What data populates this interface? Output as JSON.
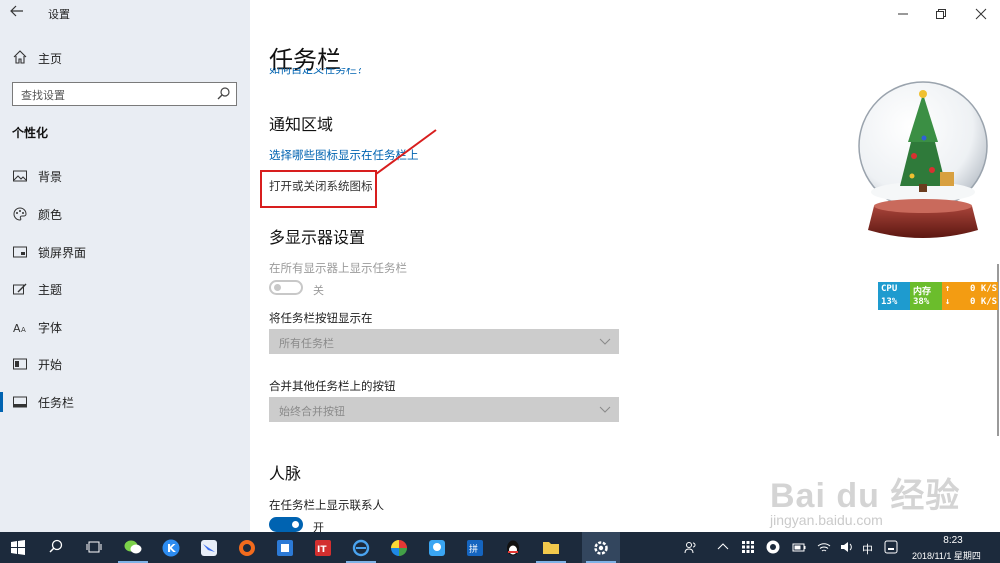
{
  "app": {
    "title": "设置"
  },
  "sidebar": {
    "home_label": "主页",
    "search_placeholder": "查找设置",
    "section_heading": "个性化",
    "items": [
      {
        "label": "背景",
        "icon": "picture-icon"
      },
      {
        "label": "颜色",
        "icon": "palette-icon"
      },
      {
        "label": "锁屏界面",
        "icon": "lock-screen-icon"
      },
      {
        "label": "主题",
        "icon": "brush-icon"
      },
      {
        "label": "字体",
        "icon": "font-icon"
      },
      {
        "label": "开始",
        "icon": "start-icon"
      },
      {
        "label": "任务栏",
        "icon": "taskbar-icon",
        "active": true
      }
    ]
  },
  "main": {
    "page_title": "任务栏",
    "truncated_link": "如何自定义任务栏？",
    "notification": {
      "heading": "通知区域",
      "link_icons": "选择哪些图标显示在任务栏上",
      "system_icons": "打开或关闭系统图标"
    },
    "multi_display": {
      "heading": "多显示器设置",
      "show_all_label": "在所有显示器上显示任务栏",
      "show_all_state": "关",
      "buttons_label": "将任务栏按钮显示在",
      "buttons_value": "所有任务栏",
      "combine_label": "合并其他任务栏上的按钮",
      "combine_value": "始终合并按钮"
    },
    "people": {
      "heading": "人脉",
      "contacts_label": "在任务栏上显示联系人",
      "contacts_state": "开"
    }
  },
  "monitor": {
    "cpu_label": "CPU",
    "cpu_value": "13%",
    "mem_label": "内存",
    "mem_value": "38%",
    "up_arrow": "↑",
    "down_arrow": "↓",
    "up_rate": "0 K/S",
    "down_rate": "0 K/S"
  },
  "watermark": {
    "brand": "Bai du 经验",
    "url": "jingyan.baidu.com"
  },
  "taskbar": {
    "ime": "中",
    "time": "8:23",
    "date": "2018/11/1 星期四"
  },
  "colors": {
    "accent": "#0063b1",
    "highlight": "#d81e1e",
    "sidebar_bg": "#e9edf3",
    "taskbar_bg": "#1c2a3c"
  }
}
